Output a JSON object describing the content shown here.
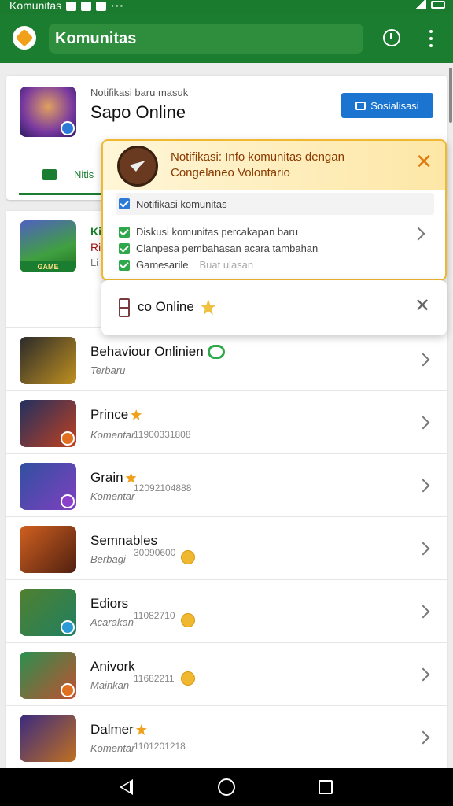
{
  "status_bar": {
    "app_label": "Komunitas"
  },
  "app_bar": {
    "title": "Komunitas"
  },
  "header": {
    "subtitle": "Notifikasi baru masuk",
    "title": "Sapo Online",
    "follow_label": "Sosialisasi",
    "tab_label": "Nitis"
  },
  "featured": {
    "line1": "Ki",
    "line2": "Ri",
    "line3": "Li",
    "icon_strip": "GAME"
  },
  "popup": {
    "title_line1": "Notifikasi: Info komunitas dengan",
    "title_line2": "Congelaneo Volontario",
    "subheader": "Notifikasi komunitas",
    "items": [
      {
        "label": "Diskusi komunitas percakapan baru"
      },
      {
        "label": "Clanpesa pembahasan acara tambahan"
      },
      {
        "label": "Gamesarile",
        "muted": "Buat ulasan"
      }
    ]
  },
  "popup2": {
    "text": "co Online"
  },
  "list_items": [
    {
      "name": "Behaviour Onlinien",
      "sub": "Terbaru",
      "code": "",
      "colors": [
        "#2a2a2a",
        "#c09020"
      ]
    },
    {
      "name": "Prince",
      "sub": "Komentar",
      "code": "11900331808",
      "colors": [
        "#203060",
        "#c04020"
      ]
    },
    {
      "name": "Grain",
      "sub": "Komentar",
      "code": "12092104888",
      "colors": [
        "#3050a0",
        "#8040c0"
      ]
    },
    {
      "name": "Semnables",
      "sub": "Berbagi",
      "code": "30090600",
      "colors": [
        "#d06020",
        "#502010"
      ]
    },
    {
      "name": "Ediors",
      "sub": "Acarakan",
      "code": "11082710",
      "colors": [
        "#508030",
        "#208060"
      ]
    },
    {
      "name": "Anivork",
      "sub": "Mainkan",
      "code": "11682211",
      "colors": [
        "#2a9050",
        "#c05030"
      ]
    },
    {
      "name": "Dalmer",
      "sub": "Komentar",
      "code": "1101201218",
      "colors": [
        "#3a2a80",
        "#c07020"
      ]
    }
  ]
}
